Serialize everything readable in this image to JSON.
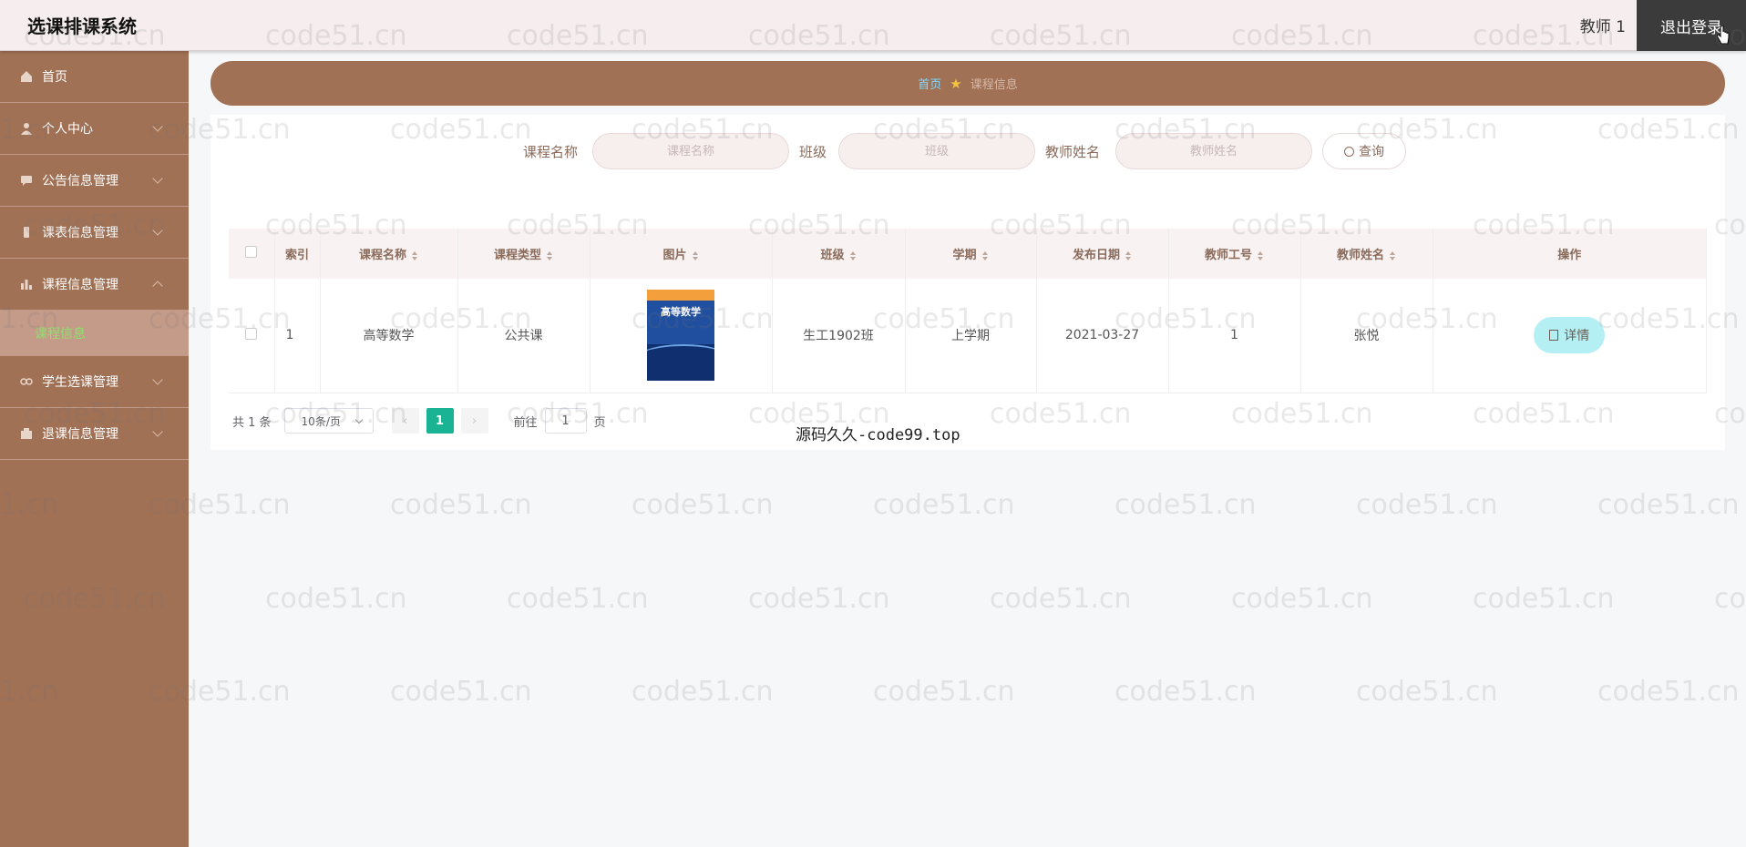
{
  "app": {
    "title": "选课排课系统"
  },
  "header": {
    "user": "教师 1",
    "logout_label": "退出登录"
  },
  "sidebar": {
    "items": [
      {
        "label": "首页",
        "icon": "home-icon"
      },
      {
        "label": "个人中心",
        "icon": "user-icon"
      },
      {
        "label": "公告信息管理",
        "icon": "chat-icon"
      },
      {
        "label": "课表信息管理",
        "icon": "phone-icon"
      },
      {
        "label": "课程信息管理",
        "icon": "chart-icon"
      },
      {
        "label": "学生选课管理",
        "icon": "link-icon"
      },
      {
        "label": "退课信息管理",
        "icon": "box-icon"
      }
    ],
    "active_sub": "课程信息"
  },
  "breadcrumb": {
    "home": "首页",
    "current": "课程信息"
  },
  "search": {
    "course_name_label": "课程名称",
    "course_name_placeholder": "课程名称",
    "class_label": "班级",
    "class_placeholder": "班级",
    "teacher_label": "教师姓名",
    "teacher_placeholder": "教师姓名",
    "query_label": "查询"
  },
  "table": {
    "headers": [
      "索引",
      "课程名称",
      "课程类型",
      "图片",
      "班级",
      "学期",
      "发布日期",
      "教师工号",
      "教师姓名",
      "操作"
    ],
    "rows": [
      {
        "index": "1",
        "course_name": "高等数学",
        "course_type": "公共课",
        "image_title": "高等数学",
        "class": "生工1902班",
        "term": "上学期",
        "date": "2021-03-27",
        "teacher_id": "1",
        "teacher_name": "张悦",
        "action": "详情"
      }
    ]
  },
  "pagination": {
    "total": "共 1 条",
    "page_size": "10条/页",
    "current_page": "1",
    "goto_label": "前往",
    "goto_value": "1",
    "page_unit": "页"
  },
  "source_note": "源码久久-code99.top",
  "watermark": "code51.cn",
  "watermark_partial": "1.cn",
  "colors": {
    "sidebar": "#a07155",
    "accent": "#1ab394",
    "detail": "#b4f0f3"
  }
}
